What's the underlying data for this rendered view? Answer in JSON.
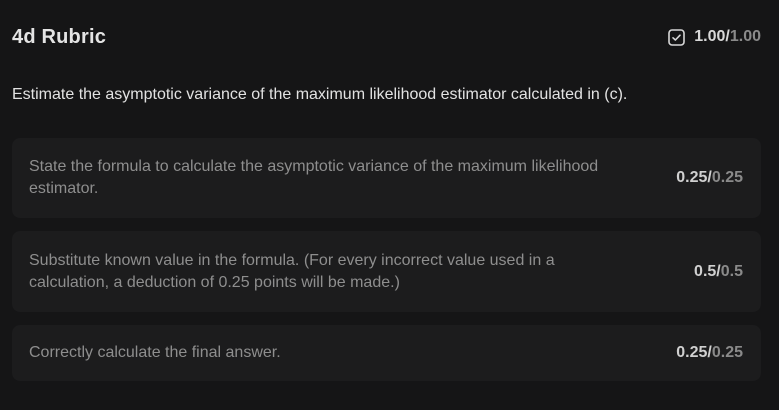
{
  "rubric": {
    "title": "4d Rubric",
    "score_got": "1.00",
    "score_sep": "/",
    "score_max": "1.00",
    "score_icon": "checkbox-checked-icon"
  },
  "question": "Estimate the asymptotic variance of the maximum likelihood estimator calculated in (c).",
  "criteria": [
    {
      "text": "State the formula to calculate the asymptotic variance of the maximum likelihood estimator.",
      "got": "0.25",
      "sep": "/",
      "max": "0.25"
    },
    {
      "text": "Substitute known value in the formula. (For every incorrect value used in a calculation, a deduction of 0.25 points will be made.)",
      "got": "0.5",
      "sep": "/",
      "max": "0.5"
    },
    {
      "text": "Correctly calculate the final answer.",
      "got": "0.25",
      "sep": "/",
      "max": "0.25"
    }
  ],
  "colors": {
    "background": "#151516",
    "card": "#1c1c1d",
    "muted_text": "#8e8e8e",
    "strong_text": "#e4e4e4"
  }
}
